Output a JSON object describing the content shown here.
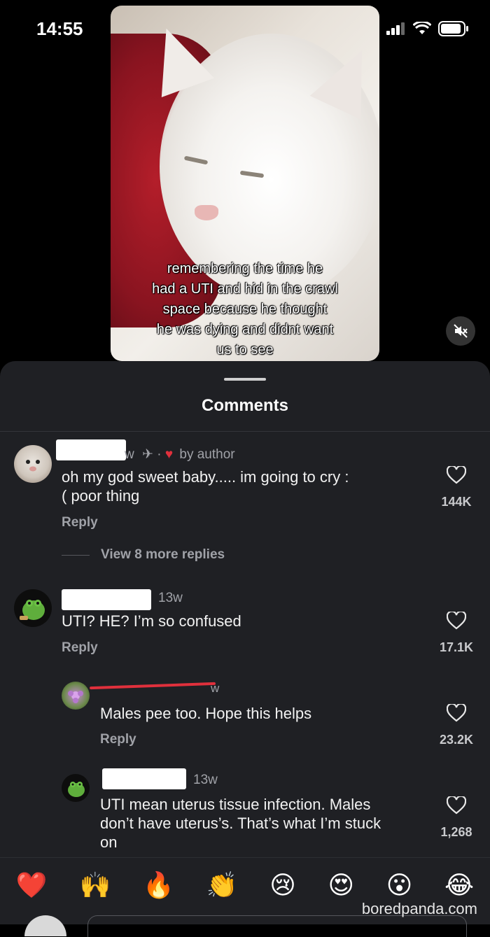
{
  "status_bar": {
    "time": "14:55"
  },
  "video": {
    "caption_lines": [
      "remembering the time he",
      "had a UTI and hid in the crawl",
      "space because he thought",
      "he was dying and didnt want",
      "us to see"
    ]
  },
  "sheet": {
    "title": "Comments"
  },
  "comments": [
    {
      "meta_suffix": "w",
      "by_author": "by author",
      "text_line1": "oh my god sweet baby..... im going to cry :",
      "text_line2": "( poor thing",
      "reply_label": "Reply",
      "likes": "144K",
      "view_more": "View 8 more replies"
    },
    {
      "age": "13w",
      "text": "UTI? HE?  I’m so confused",
      "reply_label": "Reply",
      "likes": "17.1K"
    },
    {
      "meta_suffix": "w",
      "text": "Males pee too. Hope this helps",
      "reply_label": "Reply",
      "likes": "23.2K"
    },
    {
      "age": "13w",
      "text_line1": "UTI mean uterus tissue infection. Males",
      "text_line2": "don’t have uterus’s. That’s what I’m stuck",
      "text_line3": "on",
      "likes": "1,268"
    }
  ],
  "emoji_bar": [
    "❤️",
    "🙌",
    "🔥",
    "👏",
    "😢",
    "😍",
    "😮",
    "😂"
  ],
  "watermark": "boredpanda.com",
  "colors": {
    "sheet_bg": "#1f2024",
    "heart_red": "#e0303c",
    "meta_gray": "#a0a2a8"
  }
}
